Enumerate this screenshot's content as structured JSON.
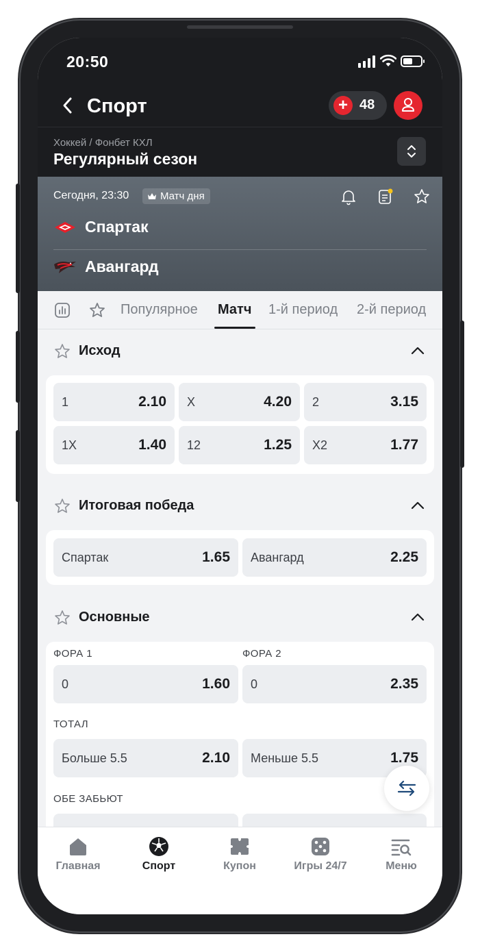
{
  "status_bar": {
    "time": "20:50"
  },
  "header": {
    "title": "Спорт",
    "coupon_count": "48"
  },
  "league": {
    "path": "Хоккей / Фонбет КХЛ",
    "name": "Регулярный сезон"
  },
  "match": {
    "time": "Сегодня, 23:30",
    "badge": "Матч дня",
    "team1": "Спартак",
    "team2": "Авангард"
  },
  "tabs": [
    {
      "label": "Популярное"
    },
    {
      "label": "Матч"
    },
    {
      "label": "1-й период"
    },
    {
      "label": "2-й период"
    }
  ],
  "active_tab": "Матч",
  "sections": {
    "outcome": {
      "title": "Исход",
      "odds": [
        {
          "label": "1",
          "value": "2.10"
        },
        {
          "label": "X",
          "value": "4.20"
        },
        {
          "label": "2",
          "value": "3.15"
        },
        {
          "label": "1X",
          "value": "1.40"
        },
        {
          "label": "12",
          "value": "1.25"
        },
        {
          "label": "X2",
          "value": "1.77"
        }
      ]
    },
    "final_win": {
      "title": "Итоговая победа",
      "odds": [
        {
          "label": "Спартак",
          "value": "1.65"
        },
        {
          "label": "Авангард",
          "value": "2.25"
        }
      ]
    },
    "main": {
      "title": "Основные",
      "handicap1_label": "ФОРА 1",
      "handicap2_label": "ФОРА 2",
      "handicap1": {
        "label": "0",
        "value": "1.60"
      },
      "handicap2": {
        "label": "0",
        "value": "2.35"
      },
      "total_label": "ТОТАЛ",
      "over": {
        "label": "Больше 5.5",
        "value": "2.10"
      },
      "under": {
        "label": "Меньше 5.5",
        "value": "1.75"
      },
      "both_score_label": "ОБЕ ЗАБЬЮТ"
    }
  },
  "bottom_nav": [
    {
      "label": "Главная",
      "icon": "home-icon"
    },
    {
      "label": "Спорт",
      "icon": "soccer-ball-icon"
    },
    {
      "label": "Купон",
      "icon": "coupon-icon"
    },
    {
      "label": "Игры 24/7",
      "icon": "dice-icon"
    },
    {
      "label": "Меню",
      "icon": "menu-search-icon"
    }
  ],
  "active_nav": "Спорт",
  "colors": {
    "accent_red": "#e5262f",
    "dark_bg": "#1b1c1f",
    "odd_bg": "#eceef1"
  }
}
